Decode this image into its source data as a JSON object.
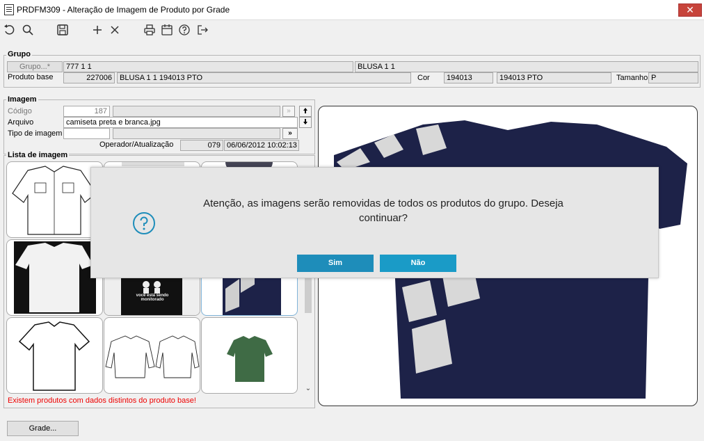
{
  "window": {
    "title": "PRDFM309 - Alteração de Imagem de Produto por Grade",
    "close_glyph": "✕"
  },
  "toolbar": {
    "icons": [
      "undo-icon",
      "search-icon",
      "save-icon",
      "add-icon",
      "cancel-icon",
      "print-icon",
      "calendar-icon",
      "help-icon",
      "exit-icon"
    ]
  },
  "grupo": {
    "section": "Grupo",
    "grupo_button": "Grupo...*",
    "grupo_code": "777 1 1",
    "grupo_desc": "BLUSA 1 1",
    "produto_base_label": "Produto base",
    "produto_code": "227006",
    "produto_desc": "BLUSA 1 1 194013 PTO",
    "cor_label": "Cor",
    "cor_code": "194013",
    "cor_desc": "194013 PTO",
    "tamanho_label": "Tamanho",
    "tamanho_value": "P"
  },
  "imagem": {
    "section": "Imagem",
    "codigo_label": "Código",
    "codigo_value": "187",
    "arquivo_label": "Arquivo",
    "arquivo_value": "camiseta preta e branca.jpg",
    "tipo_label": "Tipo de imagem",
    "tipo_value": "",
    "more_glyph": "»",
    "operador_label": "Operador/Atualização",
    "operador_value": "079",
    "atualizacao_value": "06/06/2012 10:02:13"
  },
  "lista": {
    "section": "Lista de imagem",
    "warning": "Existem produtos com dados distintos do produto base!",
    "tshirt_caption": "você está sendo monitorado"
  },
  "bottom": {
    "grade_button": "Grade..."
  },
  "dialog": {
    "message": "Atenção, as imagens serão removidas de todos os produtos do grupo. Deseja continuar?",
    "yes_label": "Sim",
    "no_label": "Não",
    "icon": "question-icon",
    "accent": "#1e8dba"
  }
}
